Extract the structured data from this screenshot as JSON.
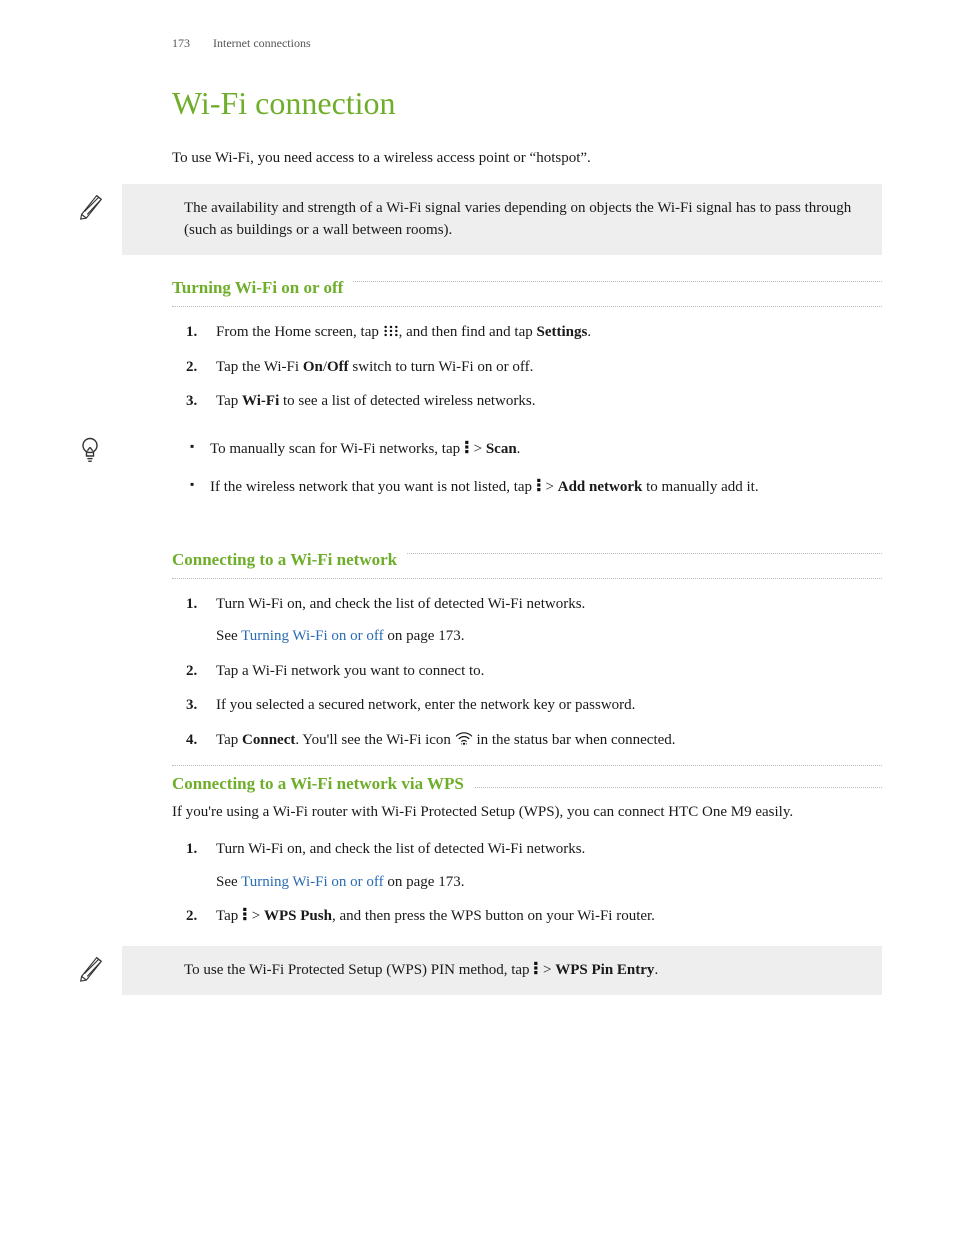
{
  "header": {
    "page_number": "173",
    "section": "Internet connections"
  },
  "title": "Wi-Fi connection",
  "intro": "To use Wi-Fi, you need access to a wireless access point or “hotspot”.",
  "note1": "The availability and strength of a Wi-Fi signal varies depending on objects the Wi-Fi signal has to pass through (such as buildings or a wall between rooms).",
  "section1": {
    "heading": "Turning Wi-Fi on or off",
    "step1_a": "From the Home screen, tap ",
    "step1_b": ", and then find and tap ",
    "step1_settings": "Settings",
    "step1_c": ".",
    "step2_a": "Tap the Wi-Fi ",
    "step2_on": "On",
    "step2_slash": "/",
    "step2_off": "Off",
    "step2_b": " switch to turn Wi-Fi on or off.",
    "step3_a": "Tap ",
    "step3_wifi": "Wi-Fi",
    "step3_b": " to see a list of detected wireless networks."
  },
  "tip1": {
    "bullet1_a": "To manually scan for Wi-Fi networks, tap ",
    "bullet1_gt": " > ",
    "bullet1_scan": "Scan",
    "bullet1_c": ".",
    "bullet2_a": "If the wireless network that you want is not listed, tap ",
    "bullet2_gt": " > ",
    "bullet2_add": "Add network",
    "bullet2_b": " to manually add it."
  },
  "section2": {
    "heading": "Connecting to a Wi-Fi network",
    "step1": "Turn Wi-Fi on, and check the list of detected Wi-Fi networks.",
    "step1_see_a": "See ",
    "step1_see_link": "Turning Wi-Fi on or off",
    "step1_see_b": " on page 173.",
    "step2": "Tap a Wi-Fi network you want to connect to.",
    "step3": "If you selected a secured network, enter the network key or password.",
    "step4_a": "Tap ",
    "step4_connect": "Connect",
    "step4_b": ". You'll see the Wi-Fi icon ",
    "step4_c": " in the status bar when connected."
  },
  "section3": {
    "heading": "Connecting to a Wi-Fi network via WPS",
    "intro": "If you're using a Wi-Fi router with Wi-Fi Protected Setup (WPS), you can connect HTC One M9 easily.",
    "step1": "Turn Wi-Fi on, and check the list of detected Wi-Fi networks.",
    "step1_see_a": "See ",
    "step1_see_link": "Turning Wi-Fi on or off",
    "step1_see_b": " on page 173.",
    "step2_a": "Tap ",
    "step2_gt": " > ",
    "step2_wps": "WPS Push",
    "step2_b": ", and then press the WPS button on your Wi-Fi router."
  },
  "note2_a": "To use the Wi-Fi Protected Setup (WPS) PIN method, tap ",
  "note2_gt": " > ",
  "note2_wpspin": "WPS Pin Entry",
  "note2_b": "."
}
